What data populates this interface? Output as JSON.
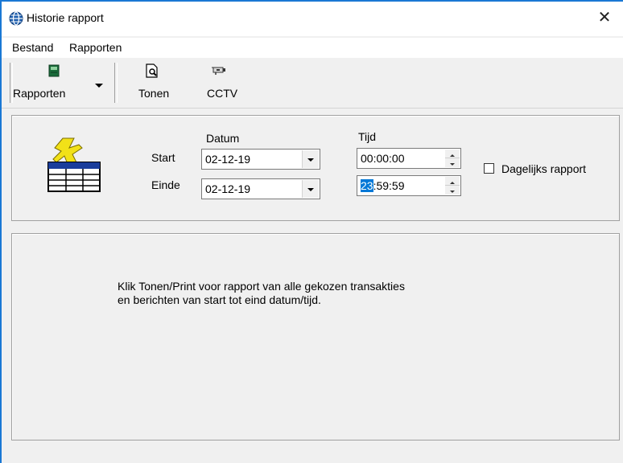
{
  "window": {
    "title": "Historie rapport",
    "close_symbol": "✕"
  },
  "menu": {
    "items": [
      {
        "label": "Bestand"
      },
      {
        "label": "Rapporten"
      }
    ]
  },
  "toolbar": {
    "rapporten": {
      "label": "Rapporten",
      "icon": "report-book-icon"
    },
    "tonen": {
      "label": "Tonen",
      "icon": "preview-document-icon"
    },
    "cctv": {
      "label": "CCTV",
      "icon": "cctv-camera-icon"
    }
  },
  "form": {
    "header_datum": "Datum",
    "header_tijd": "Tijd",
    "start_label": "Start",
    "einde_label": "Einde",
    "start_date": "02-12-19",
    "end_date": "02-12-19",
    "start_time": "00:00:00",
    "end_time_selected": "23",
    "end_time_rest": ":59:59",
    "daily_label": "Dagelijks rapport",
    "daily_checked": false
  },
  "info": {
    "line1": "Klik Tonen/Print voor rapport van alle gekozen transakties",
    "line2": "en berichten van start tot eind datum/tijd."
  },
  "colors": {
    "accent": "#0078d7",
    "border": "#1a78d4",
    "background": "#f0f0f0"
  }
}
